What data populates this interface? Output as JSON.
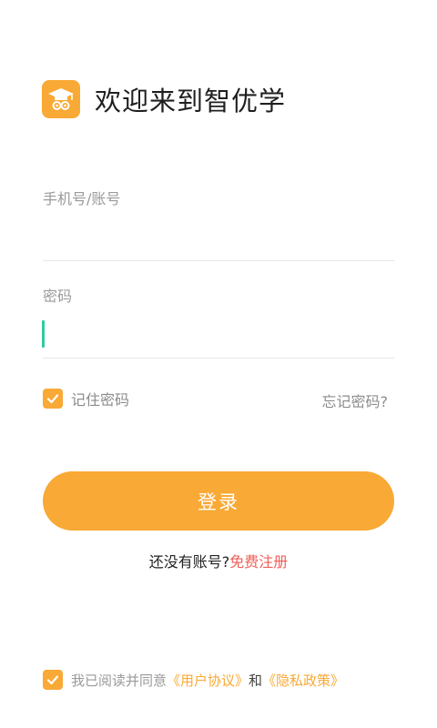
{
  "header": {
    "title": "欢迎来到智优学",
    "logo_icon": "graduation-cap-owl-icon"
  },
  "account": {
    "label": "手机号/账号",
    "value": ""
  },
  "password": {
    "label": "密码",
    "value": ""
  },
  "remember": {
    "label": "记住密码",
    "checked": true
  },
  "forgot_label": "忘记密码?",
  "login_label": "登录",
  "register": {
    "prompt": "还没有账号?",
    "link": "免费注册"
  },
  "agreement": {
    "checked": true,
    "prefix": "我已阅读并同意",
    "user_agreement": "《用户协议》",
    "and_text": "和",
    "privacy_policy": "《隐私政策》"
  },
  "colors": {
    "accent": "#F9A935",
    "link_red": "#EF5F5A",
    "caret": "#2FCAA3"
  }
}
